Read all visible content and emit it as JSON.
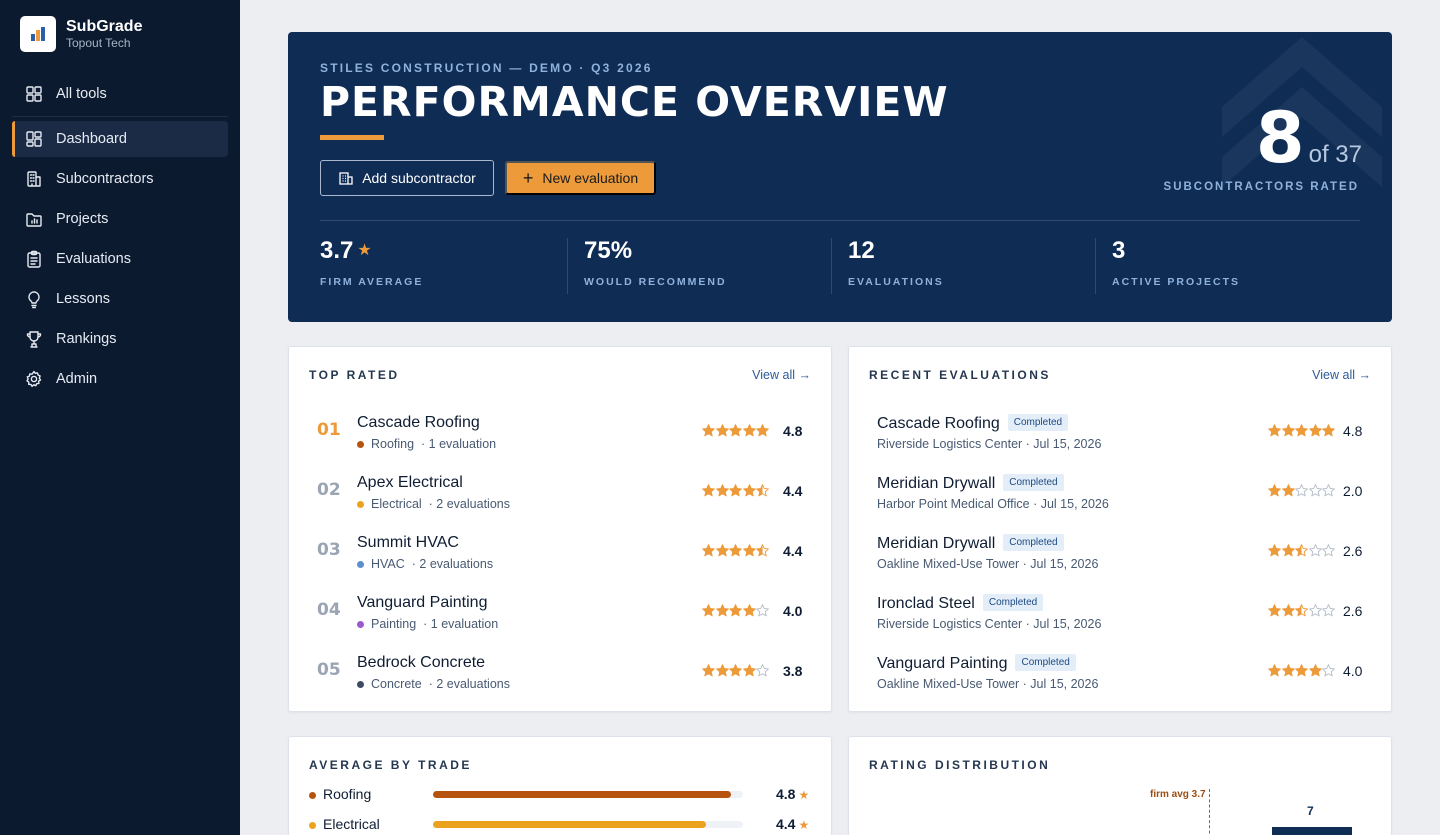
{
  "app": {
    "name": "SubGrade",
    "org": "Topout Tech"
  },
  "nav": [
    {
      "label": "All tools",
      "icon": "grid-icon"
    },
    {
      "label": "Dashboard",
      "icon": "dashboard-icon",
      "active": true
    },
    {
      "label": "Subcontractors",
      "icon": "building-icon"
    },
    {
      "label": "Projects",
      "icon": "folder-chart-icon"
    },
    {
      "label": "Evaluations",
      "icon": "clipboard-icon"
    },
    {
      "label": "Lessons",
      "icon": "lightbulb-icon"
    },
    {
      "label": "Rankings",
      "icon": "trophy-icon"
    },
    {
      "label": "Admin",
      "icon": "gear-icon"
    }
  ],
  "hero": {
    "eyebrow": "STILES CONSTRUCTION — DEMO · Q3 2026",
    "title": "PERFORMANCE OVERVIEW",
    "add_sub_label": "Add subcontractor",
    "new_eval_label": "New evaluation",
    "rated_count": "8",
    "rated_total": "of 37",
    "rated_label": "SUBCONTRACTORS RATED",
    "stats": [
      {
        "value": "3.7",
        "label": "FIRM AVERAGE",
        "star": true
      },
      {
        "value": "75%",
        "label": "WOULD RECOMMEND"
      },
      {
        "value": "12",
        "label": "EVALUATIONS"
      },
      {
        "value": "3",
        "label": "ACTIVE PROJECTS"
      }
    ]
  },
  "top_rated": {
    "title": "TOP RATED",
    "view_all": "View all →",
    "items": [
      {
        "rank": "01",
        "name": "Cascade Roofing",
        "trade": "Roofing",
        "trade_color": "#b5530f",
        "evals": "· 1 evaluation",
        "rating": 4.8,
        "score": "4.8"
      },
      {
        "rank": "02",
        "name": "Apex Electrical",
        "trade": "Electrical",
        "trade_color": "#eba21f",
        "evals": "· 2 evaluations",
        "rating": 4.4,
        "score": "4.4"
      },
      {
        "rank": "03",
        "name": "Summit HVAC",
        "trade": "HVAC",
        "trade_color": "#5b8fd0",
        "evals": "· 2 evaluations",
        "rating": 4.4,
        "score": "4.4"
      },
      {
        "rank": "04",
        "name": "Vanguard Painting",
        "trade": "Painting",
        "trade_color": "#9b59d0",
        "evals": "· 1 evaluation",
        "rating": 4.0,
        "score": "4.0"
      },
      {
        "rank": "05",
        "name": "Bedrock Concrete",
        "trade": "Concrete",
        "trade_color": "#3d4a63",
        "evals": "· 2 evaluations",
        "rating": 3.8,
        "score": "3.8"
      }
    ]
  },
  "recent": {
    "title": "RECENT EVALUATIONS",
    "view_all": "View all →",
    "items": [
      {
        "name": "Cascade Roofing",
        "status": "Completed",
        "detail": "Riverside Logistics Center · Jul 15, 2026",
        "rating": 4.8,
        "score": "4.8"
      },
      {
        "name": "Meridian Drywall",
        "status": "Completed",
        "detail": "Harbor Point Medical Office · Jul 15, 2026",
        "rating": 2.0,
        "score": "2.0"
      },
      {
        "name": "Meridian Drywall",
        "status": "Completed",
        "detail": "Oakline Mixed-Use Tower · Jul 15, 2026",
        "rating": 2.6,
        "score": "2.6"
      },
      {
        "name": "Ironclad Steel",
        "status": "Completed",
        "detail": "Riverside Logistics Center · Jul 15, 2026",
        "rating": 2.6,
        "score": "2.6"
      },
      {
        "name": "Vanguard Painting",
        "status": "Completed",
        "detail": "Oakline Mixed-Use Tower · Jul 15, 2026",
        "rating": 4.0,
        "score": "4.0"
      }
    ]
  },
  "by_trade": {
    "title": "AVERAGE BY TRADE",
    "max": 5,
    "items": [
      {
        "trade": "Roofing",
        "color": "#b5530f",
        "value": 4.8,
        "score": "4.8"
      },
      {
        "trade": "Electrical",
        "color": "#eba21f",
        "value": 4.4,
        "score": "4.4"
      }
    ]
  },
  "distribution": {
    "title": "RATING DISTRIBUTION",
    "avg_label": "firm avg 3.7",
    "bar_label": "7"
  },
  "colors": {
    "accent": "#ec9a3a",
    "navy": "#0f2c55",
    "sidebar": "#0c1a30",
    "star_empty": "#b4bcc8"
  }
}
